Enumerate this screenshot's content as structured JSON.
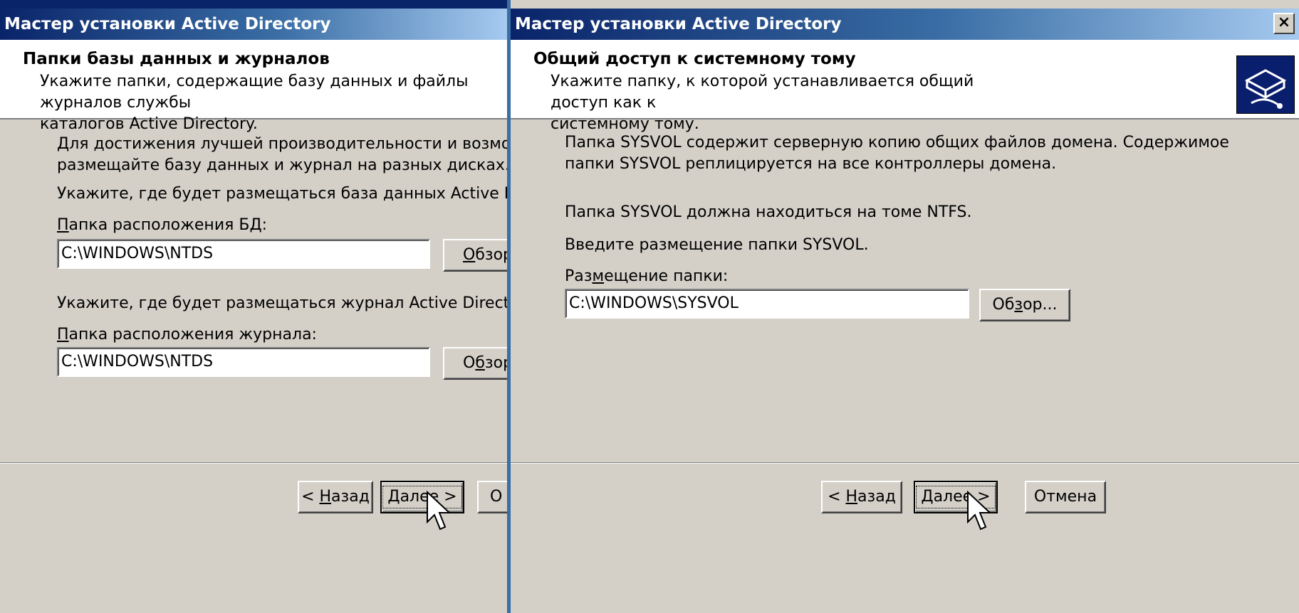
{
  "left_window": {
    "title": "Мастер установки Active Directory",
    "header": {
      "title": "Папки базы данных и журналов",
      "subtitle_line1": "Укажите папки, содержащие базу данных и файлы журналов службы",
      "subtitle_line2": "каталогов Active Directory."
    },
    "intro_line1": "Для достижения лучшей производительности и возможности восстановлени",
    "intro_line2": "размещайте базу данных и журнал на разных дисках.",
    "db_prompt": "Укажите, где будет размещаться база данных Active Directory.",
    "db_label_u": "П",
    "db_label_rest": "апка расположения БД:",
    "db_value": "C:\\WINDOWS\\NTDS",
    "db_browse_u": "О",
    "db_browse_rest": "бзор...",
    "log_prompt": "Укажите, где будет размещаться журнал Active Directory.",
    "log_label_u": "П",
    "log_label_rest": "апка расположения журнала:",
    "log_value": "C:\\WINDOWS\\NTDS",
    "log_browse_pre": "О",
    "log_browse_u": "б",
    "log_browse_rest": "зор...",
    "back_pre": "< ",
    "back_u": "Н",
    "back_rest": "азад",
    "next_u": "Д",
    "next_rest": "алее >",
    "cancel_partial": "О"
  },
  "right_window": {
    "title": "Мастер установки Active Directory",
    "close_symbol": "×",
    "header": {
      "title": "Общий доступ к системному тому",
      "subtitle_line1": "Укажите папку, к которой устанавливается общий доступ как к",
      "subtitle_line2": "системному тому."
    },
    "info_line1": "Папка SYSVOL содержит серверную копию общих файлов домена. Содержимое",
    "info_line2": "папки SYSVOL реплицируется на все контроллеры домена.",
    "ntfs_note": "Папка SYSVOL должна находиться на томе NTFS.",
    "enter_prompt": "Введите размещение папки SYSVOL.",
    "folder_label_pre": "Раз",
    "folder_label_u": "м",
    "folder_label_rest": "ещение папки:",
    "folder_value": "C:\\WINDOWS\\SYSVOL",
    "browse_pre": "Об",
    "browse_u": "з",
    "browse_rest": "ор...",
    "back_pre": "< ",
    "back_u": "Н",
    "back_rest": "азад",
    "next_u": "Д",
    "next_rest": "алее >",
    "cancel": "Отмена"
  }
}
